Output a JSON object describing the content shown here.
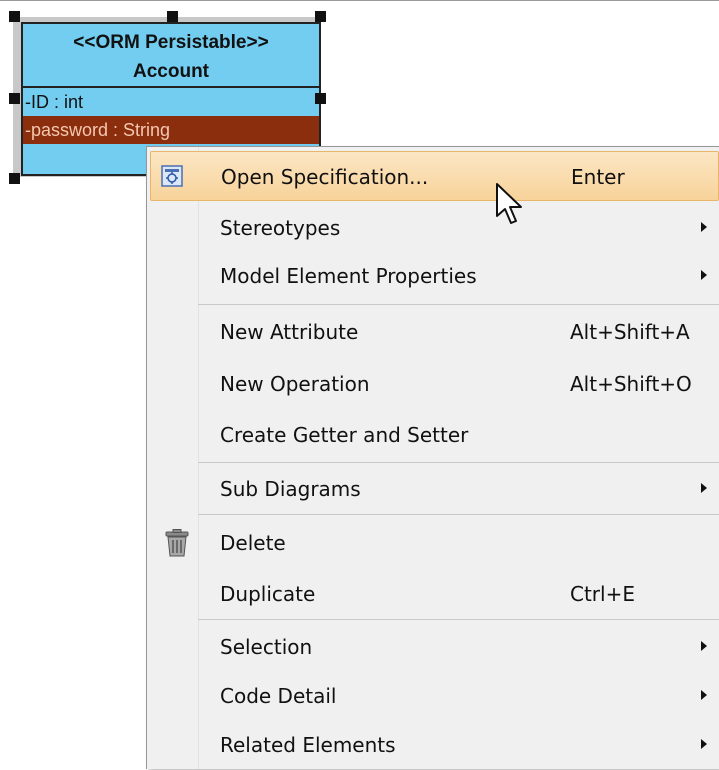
{
  "class_box": {
    "stereotype": "<<ORM Persistable>>",
    "name": "Account",
    "attributes": [
      {
        "text": "-ID : int",
        "selected": false
      },
      {
        "text": "-password : String",
        "selected": true
      }
    ]
  },
  "context_menu": {
    "items": [
      {
        "label": "Open Specification...",
        "shortcut": "Enter",
        "icon": "open-specification-icon",
        "highlighted": true
      },
      {
        "label": "Stereotypes",
        "submenu": true
      },
      {
        "label": "Model Element Properties",
        "submenu": true
      },
      {
        "label": "New Attribute",
        "shortcut": "Alt+Shift+A"
      },
      {
        "label": "New Operation",
        "shortcut": "Alt+Shift+O"
      },
      {
        "label": "Create Getter and Setter"
      },
      {
        "label": "Sub Diagrams",
        "submenu": true
      },
      {
        "label": "Delete",
        "icon": "trash-icon"
      },
      {
        "label": "Duplicate",
        "shortcut": "Ctrl+E"
      },
      {
        "label": "Selection",
        "submenu": true
      },
      {
        "label": "Code Detail",
        "submenu": true
      },
      {
        "label": "Related Elements",
        "submenu": true
      }
    ]
  },
  "colors": {
    "class_fill": "#72cdf0",
    "selected_attribute": "#8a2e0e",
    "menu_highlight": "#f8d39a"
  }
}
